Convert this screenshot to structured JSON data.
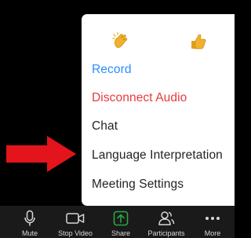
{
  "colors": {
    "record": "#2d8cff",
    "disconnect": "#e8393c",
    "item_text": "#232323",
    "arrow": "#e3141b",
    "share_icon": "#27a843",
    "reaction_yellow": "#f2b12c"
  },
  "reactions": [
    {
      "icon": "clapping-hands-icon"
    },
    {
      "icon": "thumbs-up-icon"
    }
  ],
  "menu": {
    "items": [
      {
        "label": "Record"
      },
      {
        "label": "Disconnect Audio"
      },
      {
        "label": "Chat"
      },
      {
        "label": "Language Interpretation"
      },
      {
        "label": "Meeting Settings"
      }
    ]
  },
  "toolbar": {
    "buttons": [
      {
        "label": "Mute",
        "icon": "microphone-icon"
      },
      {
        "label": "Stop Video",
        "icon": "video-camera-icon"
      },
      {
        "label": "Share",
        "icon": "share-screen-icon"
      },
      {
        "label": "Participants",
        "icon": "participants-icon"
      },
      {
        "label": "More",
        "icon": "more-dots-icon"
      }
    ]
  }
}
